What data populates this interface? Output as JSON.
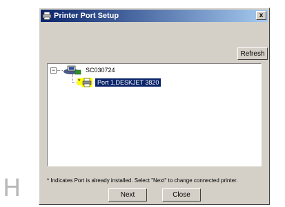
{
  "background": {
    "letter": "H"
  },
  "window": {
    "title": "Printer Port Setup",
    "close_label": "x",
    "icons": {
      "title": "printer-icon",
      "close": "close-icon"
    },
    "colors": {
      "titlebar_start": "#0a246a",
      "titlebar_end": "#a6caf0",
      "face": "#d4d0c8",
      "selection": "#0a246a",
      "installed_marker": "#ffff00"
    }
  },
  "toolbar": {
    "refresh_label": "Refresh"
  },
  "tree": {
    "expander": "−",
    "root": {
      "label": "SC030724",
      "icon": "network-computer-icon"
    },
    "children": [
      {
        "label": "Port 1,DESKJET 3820",
        "icon": "printer-icon",
        "marker": "*",
        "selected": true
      }
    ]
  },
  "footer": {
    "note": "* Indicates Port is already installed. Select \"Next\" to change connected printer.",
    "next_label": "Next",
    "close_label": "Close"
  }
}
